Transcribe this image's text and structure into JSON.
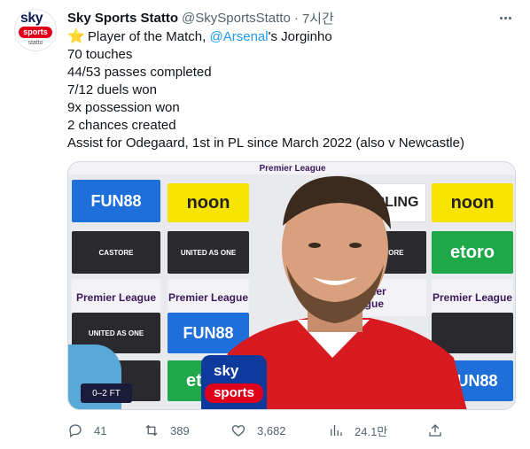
{
  "account": {
    "avatar_text": {
      "line1": "sky",
      "line2": "sports",
      "line3": "statto"
    },
    "name": "Sky Sports Statto",
    "handle": "@SkySportsStatto",
    "separator": "·",
    "time": "7시간"
  },
  "tweet": {
    "star_icon": "⭐",
    "line1_prefix": "Player of the Match, ",
    "line1_mention": "@Arsenal",
    "line1_suffix": "'s Jorginho",
    "lines": [
      "70 touches",
      "44/53 passes completed",
      "7/12 duels won",
      "9x possession won",
      "2 chances created",
      "Assist for Odegaard, 1st in PL since March 2022 (also v Newcastle)"
    ]
  },
  "media": {
    "boards": {
      "premier": "Premier League",
      "fun88": "FUN88",
      "noon": "noon",
      "carling": "CARLING",
      "etoro": "etoro",
      "castore": "CASTORE",
      "united": "UNITED AS ONE"
    },
    "score": "0–2 FT",
    "mic": {
      "sky": "sky",
      "sports": "sports"
    }
  },
  "actions": {
    "replies": "41",
    "retweets": "389",
    "likes": "3,682",
    "views": "24.1만"
  },
  "colors": {
    "link": "#1d9bf0",
    "muted": "#536471",
    "text": "#0f1419"
  }
}
